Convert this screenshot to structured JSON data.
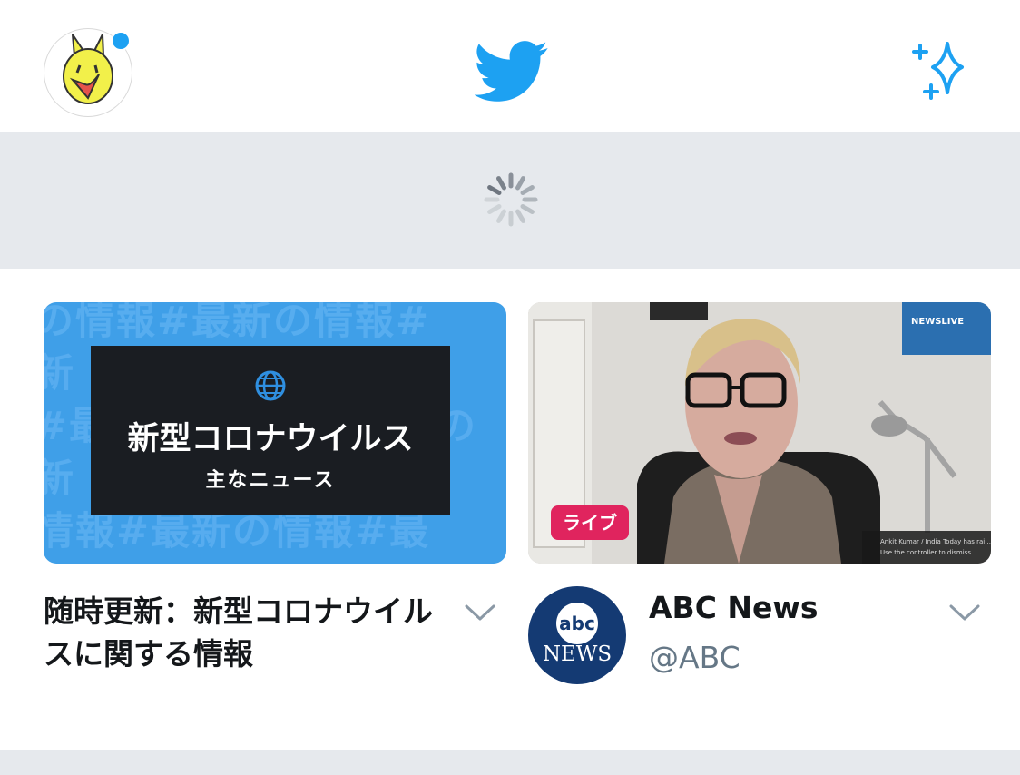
{
  "header": {
    "avatar_icon": "user-avatar",
    "logo_icon": "twitter-bird-icon",
    "sparkle_icon": "sparkle-icon",
    "brand_color": "#1da1f2"
  },
  "refresh": {
    "spinner_icon": "loading-spinner"
  },
  "cards": [
    {
      "thumb_background_text": "の情報#最新の情報#\n新　　　　　　　情報\n#最　　　　　　　新の\n新　　　　　　　情報\n情報#最新の情報#最",
      "thumb_box_title": "新型コロナウイルス",
      "thumb_box_subtitle": "主なニュース",
      "title": "随時更新：新型コロナウイルスに関する情報"
    },
    {
      "live_badge": "ライブ",
      "overlay_logo": "NEWSLIVE",
      "caption_line1": "Ankit Kumar / India Today has rai...",
      "caption_line2": "Use the controller to dismiss.",
      "logo_small": "abc",
      "logo_large": "NEWS",
      "account_name": "ABC News",
      "account_handle": "@ABC"
    }
  ]
}
